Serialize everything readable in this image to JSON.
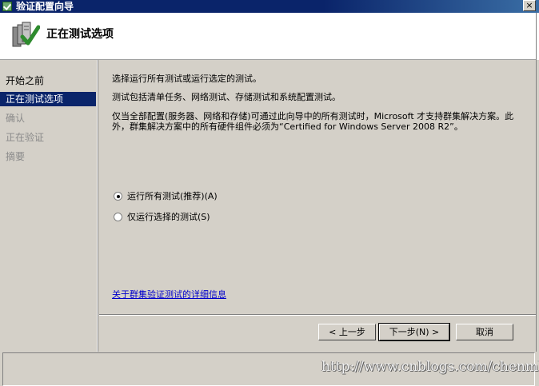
{
  "window": {
    "title": "验证配置向导",
    "close_label": "×"
  },
  "header": {
    "title": "正在测试选项"
  },
  "sidebar": {
    "items": [
      {
        "label": "开始之前",
        "state": "normal"
      },
      {
        "label": "正在测试选项",
        "state": "active"
      },
      {
        "label": "确认",
        "state": "disabled"
      },
      {
        "label": "正在验证",
        "state": "disabled"
      },
      {
        "label": "摘要",
        "state": "disabled"
      }
    ]
  },
  "main": {
    "intro": "选择运行所有测试或运行选定的测试。",
    "description": "测试包括清单任务、网络测试、存储测试和系统配置测试。",
    "note": "仅当全部配置(服务器、网络和存储)可通过此向导中的所有测试时，Microsoft 才支持群集解决方案。此外，群集解决方案中的所有硬件组件必须为“Certified for Windows Server 2008 R2”。",
    "options": [
      {
        "label": "运行所有测试(推荐)(A)",
        "checked": true
      },
      {
        "label": "仅运行选择的测试(S)",
        "checked": false
      }
    ],
    "link": "关于群集验证测试的详细信息"
  },
  "buttons": {
    "back": "< 上一步",
    "next": "下一步(N) >",
    "cancel": "取消"
  },
  "watermark": "http://www.cnblogs.com/chenmh/",
  "colors": {
    "title_bar": "#0a246a",
    "active_item": "#0a246a",
    "link": "#0000cc",
    "dialog_bg": "#d4d0c8"
  }
}
